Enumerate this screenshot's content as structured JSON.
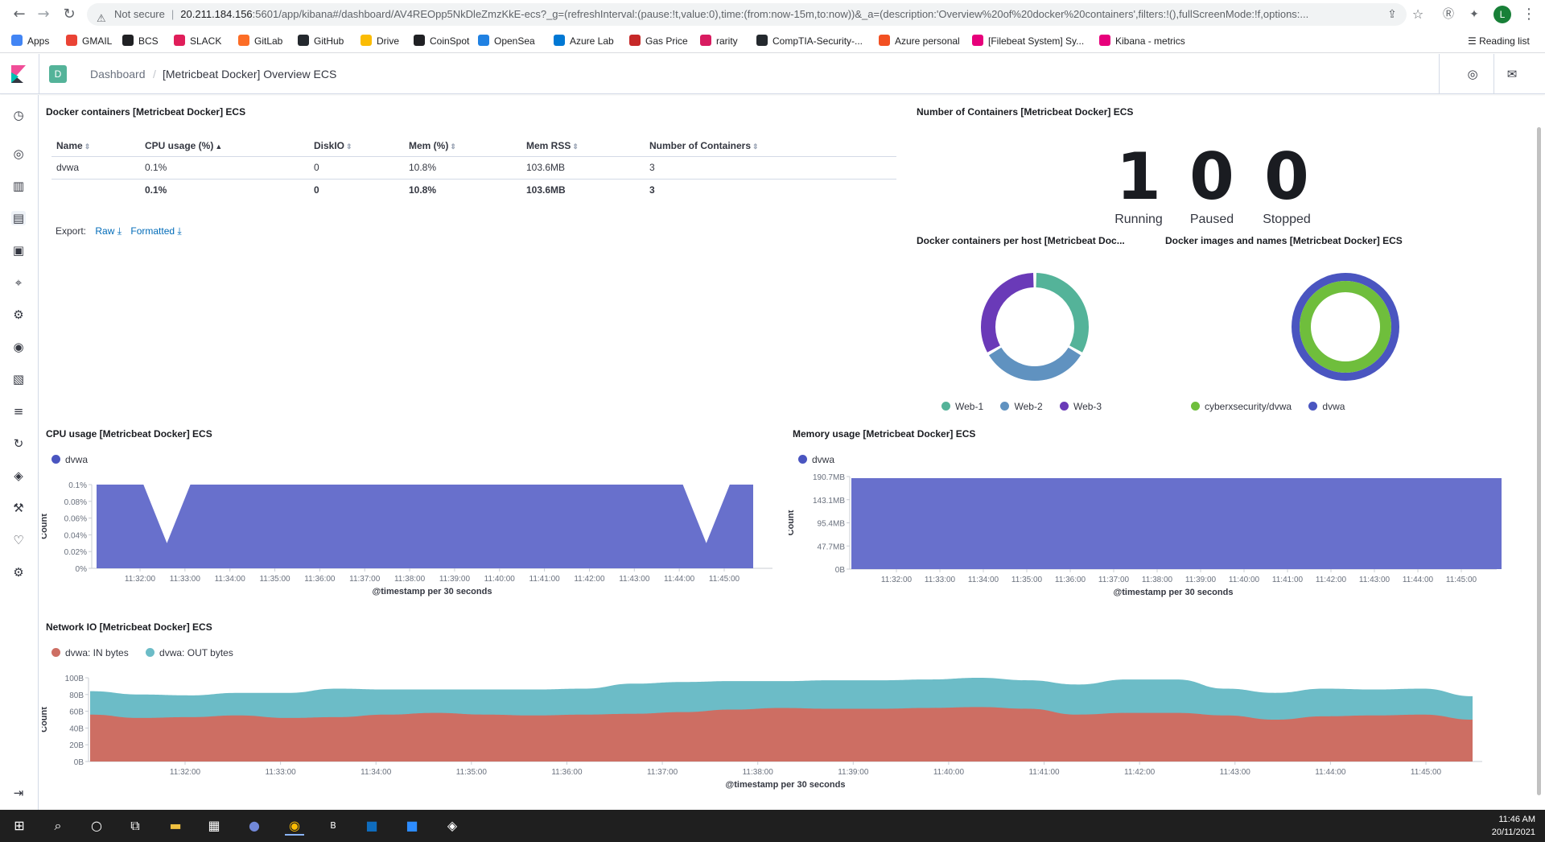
{
  "browser": {
    "not_secure": "Not secure",
    "url_host": "20.211.184.156",
    "url_rest": ":5601/app/kibana#/dashboard/AV4REOpp5NkDleZmzKkE-ecs?_g=(refreshInterval:(pause:!t,value:0),time:(from:now-15m,to:now))&_a=(description:'Overview%20of%20docker%20containers',filters:!(),fullScreenMode:!f,options:...",
    "profile_initial": "L",
    "reading_list": "Reading list",
    "bookmarks": [
      {
        "label": "Apps",
        "color": "#4285f4"
      },
      {
        "label": "GMAIL",
        "color": "#ea4335"
      },
      {
        "label": "BCS",
        "color": "#202124"
      },
      {
        "label": "SLACK",
        "color": "#e01e5a"
      },
      {
        "label": "GitLab",
        "color": "#fc6d26"
      },
      {
        "label": "GitHub",
        "color": "#24292e"
      },
      {
        "label": "Drive",
        "color": "#fbbc04"
      },
      {
        "label": "CoinSpot",
        "color": "#202124"
      },
      {
        "label": "OpenSea",
        "color": "#2081e2"
      },
      {
        "label": "Azure Lab",
        "color": "#0078d4"
      },
      {
        "label": "Gas Price",
        "color": "#c62828"
      },
      {
        "label": "rarity",
        "color": "#d81b60"
      },
      {
        "label": "CompTIA-Security-...",
        "color": "#24292e"
      },
      {
        "label": "Azure personal",
        "color": "#f25022"
      },
      {
        "label": "[Filebeat System] Sy...",
        "color": "#e7007b"
      },
      {
        "label": "Kibana - metrics",
        "color": "#e7007b"
      }
    ]
  },
  "kibana": {
    "space_initial": "D",
    "breadcrumb_root": "Dashboard",
    "breadcrumb_current": "[Metricbeat Docker] Overview ECS"
  },
  "table_panel": {
    "title": "Docker containers [Metricbeat Docker] ECS",
    "columns": [
      "Name",
      "CPU usage (%)",
      "DiskIO",
      "Mem (%)",
      "Mem RSS",
      "Number of Containers"
    ],
    "rows": [
      [
        "dvwa",
        "0.1%",
        "0",
        "10.8%",
        "103.6MB",
        "3"
      ]
    ],
    "totals": [
      "",
      "0.1%",
      "0",
      "10.8%",
      "103.6MB",
      "3"
    ],
    "export_label": "Export:",
    "export_raw": "Raw",
    "export_formatted": "Formatted"
  },
  "containers_panel": {
    "title": "Number of Containers [Metricbeat Docker] ECS",
    "running": "1",
    "running_label": "Running",
    "paused": "0",
    "paused_label": "Paused",
    "stopped": "0",
    "stopped_label": "Stopped"
  },
  "per_host_panel": {
    "title": "Docker containers per host [Metricbeat Doc...",
    "legend": [
      {
        "label": "Web-1",
        "color": "#54b399"
      },
      {
        "label": "Web-2",
        "color": "#6092c0"
      },
      {
        "label": "Web-3",
        "color": "#6a3ab8"
      }
    ]
  },
  "images_panel": {
    "title": "Docker images and names [Metricbeat Docker] ECS",
    "legend": [
      {
        "label": "cyberxsecurity/dvwa",
        "color": "#6fbe3c"
      },
      {
        "label": "dvwa",
        "color": "#4a55c0"
      }
    ]
  },
  "cpu_panel": {
    "title": "CPU usage [Metricbeat Docker] ECS",
    "legend": "dvwa",
    "ylabel": "Count",
    "xlabel": "@timestamp per 30 seconds",
    "yticks": [
      "0.1%",
      "0.08%",
      "0.06%",
      "0.04%",
      "0.02%",
      "0%"
    ],
    "xticks": [
      "11:32:00",
      "11:33:00",
      "11:34:00",
      "11:35:00",
      "11:36:00",
      "11:37:00",
      "11:38:00",
      "11:39:00",
      "11:40:00",
      "11:41:00",
      "11:42:00",
      "11:43:00",
      "11:44:00",
      "11:45:00"
    ]
  },
  "mem_panel": {
    "title": "Memory usage [Metricbeat Docker] ECS",
    "legend": "dvwa",
    "ylabel": "Count",
    "xlabel": "@timestamp per 30 seconds",
    "yticks": [
      "190.7MB",
      "143.1MB",
      "95.4MB",
      "47.7MB",
      "0B"
    ],
    "xticks": [
      "11:32:00",
      "11:33:00",
      "11:34:00",
      "11:35:00",
      "11:36:00",
      "11:37:00",
      "11:38:00",
      "11:39:00",
      "11:40:00",
      "11:41:00",
      "11:42:00",
      "11:43:00",
      "11:44:00",
      "11:45:00"
    ]
  },
  "net_panel": {
    "title": "Network IO [Metricbeat Docker] ECS",
    "legend_in": "dvwa: IN bytes",
    "legend_out": "dvwa: OUT bytes",
    "ylabel": "Count",
    "xlabel": "@timestamp per 30 seconds",
    "yticks": [
      "100B",
      "80B",
      "60B",
      "40B",
      "20B",
      "0B"
    ],
    "xticks": [
      "11:32:00",
      "11:33:00",
      "11:34:00",
      "11:35:00",
      "11:36:00",
      "11:37:00",
      "11:38:00",
      "11:39:00",
      "11:40:00",
      "11:41:00",
      "11:42:00",
      "11:43:00",
      "11:44:00",
      "11:45:00"
    ]
  },
  "chart_data": [
    {
      "type": "table",
      "columns": [
        "Name",
        "CPU usage (%)",
        "DiskIO",
        "Mem (%)",
        "Mem RSS",
        "Number of Containers"
      ],
      "rows": [
        [
          "dvwa",
          "0.1%",
          "0",
          "10.8%",
          "103.6MB",
          "3"
        ]
      ]
    },
    {
      "type": "pie",
      "title": "Docker containers per host [Metricbeat Doc...",
      "categories": [
        "Web-1",
        "Web-2",
        "Web-3"
      ],
      "values": [
        1,
        1,
        1
      ],
      "colors": [
        "#54b399",
        "#6092c0",
        "#6a3ab8"
      ]
    },
    {
      "type": "pie",
      "title": "Docker images and names [Metricbeat Docker] ECS",
      "rings": [
        {
          "categories": [
            "dvwa"
          ],
          "values": [
            1
          ],
          "colors": [
            "#4a55c0"
          ]
        },
        {
          "categories": [
            "cyberxsecurity/dvwa"
          ],
          "values": [
            1
          ],
          "colors": [
            "#6fbe3c"
          ]
        }
      ]
    },
    {
      "type": "area",
      "title": "CPU usage [Metricbeat Docker] ECS",
      "ylabel": "Count",
      "xlabel": "@timestamp per 30 seconds",
      "ylim": [
        0,
        0.1
      ],
      "series": [
        {
          "name": "dvwa",
          "color": "#6870cc",
          "x": [
            "11:31:30",
            "11:32:00",
            "11:32:30",
            "11:33:00",
            "11:33:30",
            "11:34:00",
            "11:34:30",
            "11:35:00",
            "11:35:30",
            "11:36:00",
            "11:36:30",
            "11:37:00",
            "11:37:30",
            "11:38:00",
            "11:38:30",
            "11:39:00",
            "11:39:30",
            "11:40:00",
            "11:40:30",
            "11:41:00",
            "11:41:30",
            "11:42:00",
            "11:42:30",
            "11:43:00",
            "11:43:30",
            "11:44:00",
            "11:44:30",
            "11:45:00",
            "11:45:30"
          ],
          "values": [
            0.1,
            0.1,
            0.1,
            0.03,
            0.1,
            0.1,
            0.1,
            0.1,
            0.1,
            0.1,
            0.1,
            0.1,
            0.1,
            0.1,
            0.1,
            0.1,
            0.1,
            0.1,
            0.1,
            0.1,
            0.1,
            0.1,
            0.1,
            0.1,
            0.1,
            0.1,
            0.03,
            0.1,
            0.1
          ]
        }
      ]
    },
    {
      "type": "area",
      "title": "Memory usage [Metricbeat Docker] ECS",
      "ylabel": "Count",
      "xlabel": "@timestamp per 30 seconds",
      "ylim": [
        0,
        190.7
      ],
      "series": [
        {
          "name": "dvwa",
          "color": "#6870cc",
          "x": [
            "11:31:30",
            "11:45:30"
          ],
          "values": [
            190.7,
            190.7
          ]
        }
      ]
    },
    {
      "type": "area",
      "title": "Network IO [Metricbeat Docker] ECS",
      "ylabel": "Count",
      "xlabel": "@timestamp per 30 seconds",
      "ylim": [
        0,
        100
      ],
      "x": [
        "11:31:30",
        "11:32:00",
        "11:32:30",
        "11:33:00",
        "11:33:30",
        "11:34:00",
        "11:34:30",
        "11:35:00",
        "11:35:30",
        "11:36:00",
        "11:36:30",
        "11:37:00",
        "11:37:30",
        "11:38:00",
        "11:38:30",
        "11:39:00",
        "11:39:30",
        "11:40:00",
        "11:40:30",
        "11:41:00",
        "11:41:30",
        "11:42:00",
        "11:42:30",
        "11:43:00",
        "11:43:30",
        "11:44:00",
        "11:44:30",
        "11:45:00",
        "11:45:30"
      ],
      "series": [
        {
          "name": "dvwa: IN bytes",
          "color": "#cd6e63",
          "values": [
            56,
            52,
            53,
            55,
            52,
            53,
            56,
            58,
            56,
            55,
            56,
            57,
            59,
            62,
            64,
            63,
            63,
            64,
            65,
            63,
            56,
            58,
            58,
            55,
            50,
            54,
            55,
            56,
            50
          ]
        },
        {
          "name": "dvwa: OUT bytes",
          "color": "#6cbcc7",
          "values": [
            28,
            28,
            26,
            27,
            30,
            34,
            30,
            28,
            30,
            31,
            31,
            36,
            36,
            34,
            32,
            34,
            34,
            34,
            35,
            34,
            36,
            40,
            40,
            32,
            32,
            33,
            31,
            31,
            28
          ]
        }
      ]
    }
  ],
  "taskbar": {
    "time": "11:46 AM",
    "date": "20/11/2021"
  }
}
